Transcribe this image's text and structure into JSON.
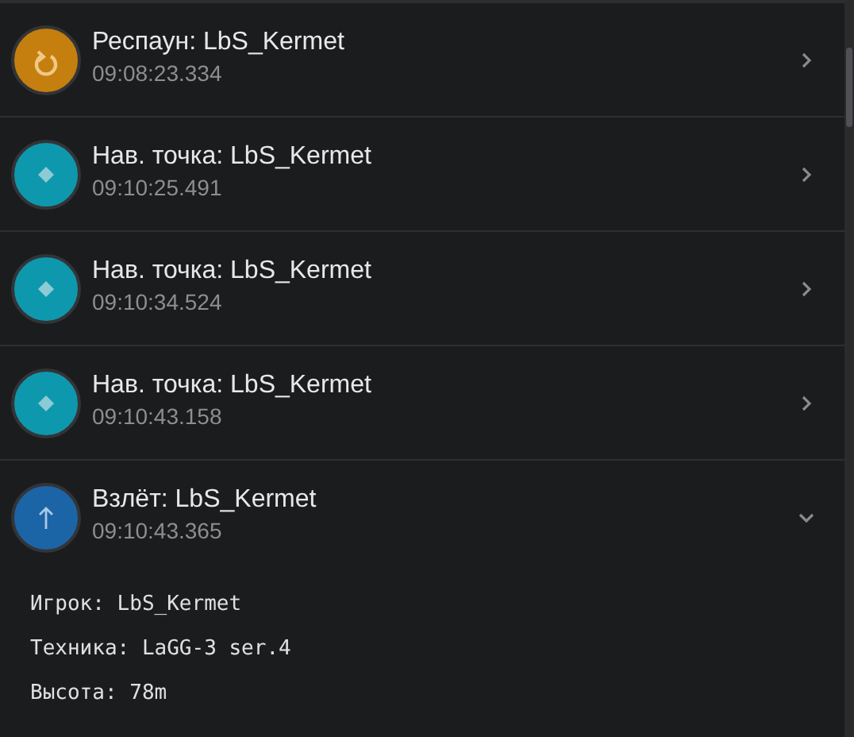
{
  "events": [
    {
      "kind": "respawn",
      "title": "Респаун: LbS_Kermet",
      "time": "09:08:23.334",
      "expanded": false
    },
    {
      "kind": "waypoint",
      "title": "Нав. точка: LbS_Kermet",
      "time": "09:10:25.491",
      "expanded": false
    },
    {
      "kind": "waypoint",
      "title": "Нав. точка: LbS_Kermet",
      "time": "09:10:34.524",
      "expanded": false
    },
    {
      "kind": "waypoint",
      "title": "Нав. точка: LbS_Kermet",
      "time": "09:10:43.158",
      "expanded": false
    },
    {
      "kind": "takeoff",
      "title": "Взлёт: LbS_Kermet",
      "time": "09:10:43.365",
      "expanded": true,
      "details": [
        "Игрок: LbS_Kermet",
        "Техника: LaGG-3 ser.4",
        "Высота: 78m"
      ]
    }
  ]
}
